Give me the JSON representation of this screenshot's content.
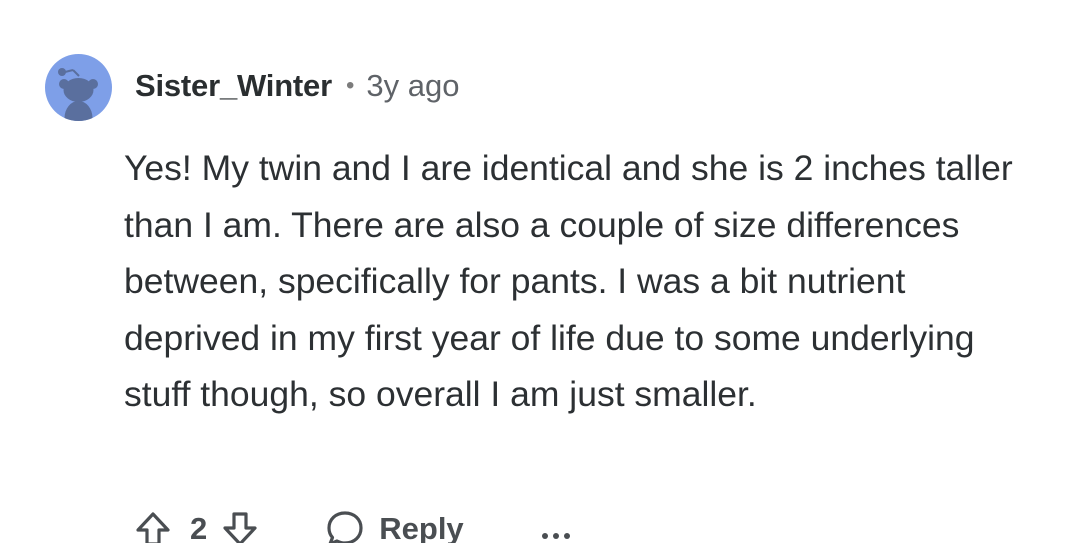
{
  "comment": {
    "author": "Sister_Winter",
    "separator": "•",
    "age": "3y ago",
    "body": "Yes! My twin and I are identical and she is 2 inches taller than I am. There are also a couple of size differences between, specifically for pants. I was a bit nutrient deprived in my first year of life due to some underlying stuff though, so overall I am just smaller."
  },
  "actions": {
    "upvote_icon": "upvote-arrow-icon",
    "vote_count": "2",
    "downvote_icon": "downvote-arrow-icon",
    "reply_icon": "speech-bubble-icon",
    "reply_label": "Reply",
    "more_icon": "ellipsis-icon"
  },
  "colors": {
    "avatar_bg": "#7e9fe8",
    "avatar_figure": "#5a6f9e",
    "text": "#2c3033",
    "meta": "#5f6368",
    "action": "#4a4e52"
  }
}
